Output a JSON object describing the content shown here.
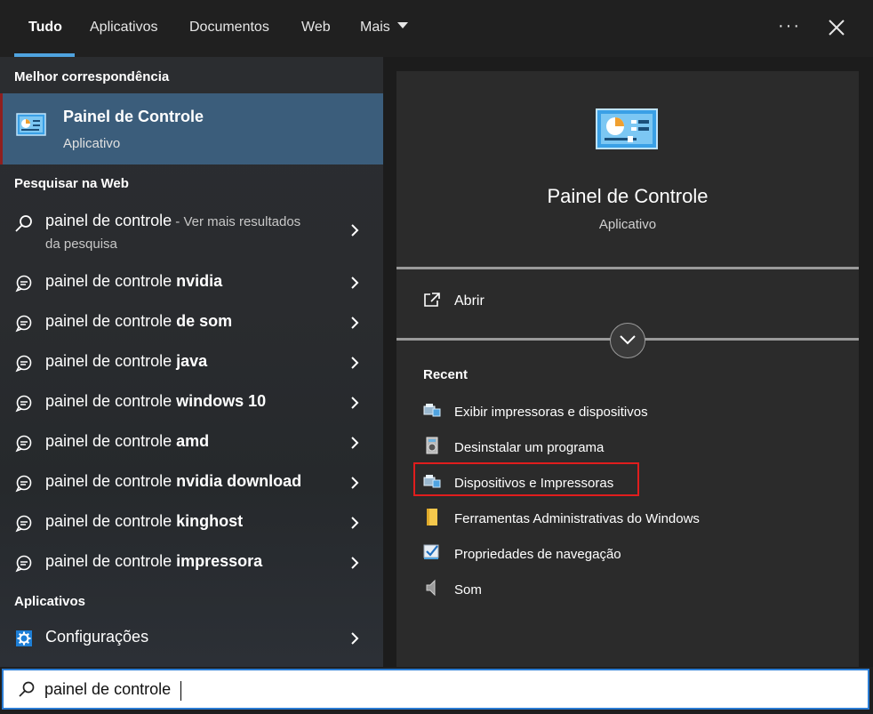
{
  "tabs": [
    {
      "label": "Tudo",
      "active": true
    },
    {
      "label": "Aplicativos"
    },
    {
      "label": "Documentos"
    },
    {
      "label": "Web"
    },
    {
      "label": "Mais"
    }
  ],
  "more_label": "···",
  "left": {
    "best_header": "Melhor correspondência",
    "best_match": {
      "title": "Painel de Controle",
      "subtitle": "Aplicativo",
      "icon": "control-panel-icon"
    },
    "web_header": "Pesquisar na Web",
    "web_first": {
      "text": "painel de controle",
      "hint": " - Ver mais resultados",
      "line2": "da pesquisa"
    },
    "suggestions": [
      {
        "prefix": "painel de controle ",
        "bold": "nvidia"
      },
      {
        "prefix": "painel de controle ",
        "bold": "de som"
      },
      {
        "prefix": "painel de controle ",
        "bold": "java"
      },
      {
        "prefix": "painel de controle ",
        "bold": "windows 10"
      },
      {
        "prefix": "painel de controle ",
        "bold": "amd"
      },
      {
        "prefix": "painel de controle ",
        "bold": "nvidia download"
      },
      {
        "prefix": "painel de controle ",
        "bold": "kinghost"
      },
      {
        "prefix": "painel de controle ",
        "bold": "impressora"
      }
    ],
    "apps_header": "Aplicativos",
    "apps": [
      {
        "label": "Configurações",
        "icon": "gear-icon"
      }
    ]
  },
  "right": {
    "title": "Painel de Controle",
    "subtitle": "Aplicativo",
    "open_label": "Abrir",
    "recent_header": "Recent",
    "recent": [
      {
        "label": "Exibir impressoras e dispositivos",
        "icon": "devices-printers-icon"
      },
      {
        "label": "Desinstalar um programa",
        "icon": "uninstall-program-icon"
      },
      {
        "label": "Dispositivos e Impressoras",
        "icon": "devices-printers-icon",
        "highlighted": true
      },
      {
        "label": "Ferramentas Administrativas do Windows",
        "icon": "folder-icon"
      },
      {
        "label": "Propriedades de navegação",
        "icon": "internet-options-icon"
      },
      {
        "label": "Som",
        "icon": "speaker-icon"
      }
    ]
  },
  "search": {
    "value": "painel de controle"
  },
  "colors": {
    "accent": "#4fa3e0",
    "selected_bg": "#3b5d7b",
    "highlight_box": "#e01d1d",
    "search_border": "#2b7cd3"
  }
}
